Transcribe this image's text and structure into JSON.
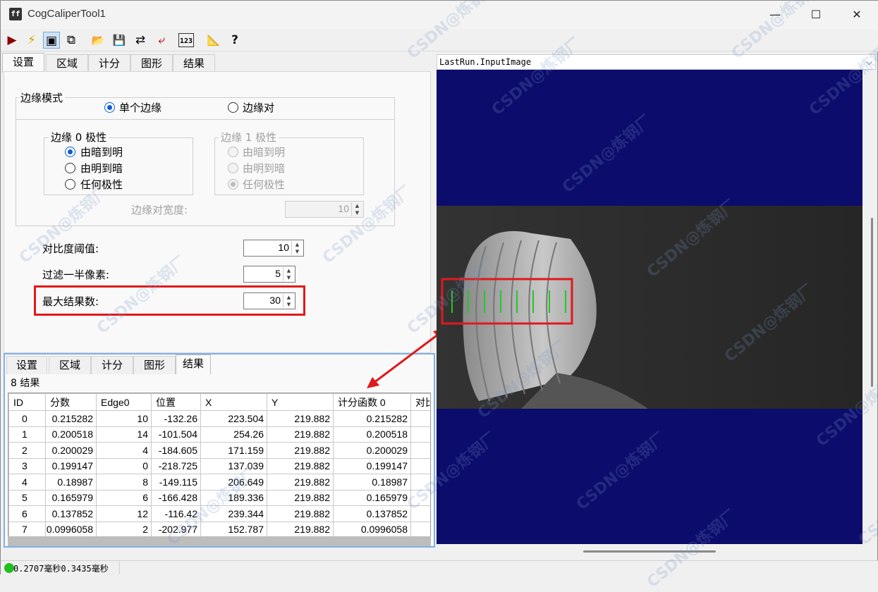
{
  "window": {
    "title": "CogCaliperTool1",
    "minimize": "—",
    "maximize": "☐",
    "close": "✕"
  },
  "toolbar": {
    "icons": [
      "run-icon",
      "electric-icon",
      "show-image-icon",
      "copy-image-icon",
      "open-icon",
      "save-icon",
      "reset-icon",
      "import-icon",
      "number-icon",
      "measure-icon",
      "help-icon"
    ],
    "glyphs": [
      "▶",
      "⚡",
      "▣",
      "⧉",
      "📂",
      "💾",
      "⇄",
      "⤶",
      "123",
      "📐",
      "?"
    ],
    "colors": {
      "run": "#8b0000",
      "lightning": "#f2c80f"
    }
  },
  "top_tabs": [
    "设置",
    "区域",
    "计分",
    "图形",
    "结果"
  ],
  "settings": {
    "edge_mode_title": "边缘模式",
    "edge_mode_single": "单个边缘",
    "edge_mode_pair": "边缘对",
    "edge0_title": "边缘 0 极性",
    "edge1_title": "边缘 1 极性",
    "polarity_options": [
      "由暗到明",
      "由明到暗",
      "任何极性"
    ],
    "pair_width_label": "边缘对宽度:",
    "pair_width_value": "10",
    "contrast_label": "对比度阈值:",
    "contrast_value": "10",
    "filter_label": "过滤一半像素:",
    "filter_value": "5",
    "max_results_label": "最大结果数:",
    "max_results_value": "30"
  },
  "results": {
    "tabs": [
      "设置",
      "区域",
      "计分",
      "图形",
      "结果"
    ],
    "count_label": "8 结果",
    "columns": [
      "ID",
      "分数",
      "Edge0",
      "位置",
      "X",
      "Y",
      "计分函数 0",
      "对比"
    ],
    "rows": [
      [
        "0",
        "0.215282",
        "10",
        "-132.26",
        "223.504",
        "219.882",
        "0.215282"
      ],
      [
        "1",
        "0.200518",
        "14",
        "-101.504",
        "254.26",
        "219.882",
        "0.200518"
      ],
      [
        "2",
        "0.200029",
        "4",
        "-184.605",
        "171.159",
        "219.882",
        "0.200029"
      ],
      [
        "3",
        "0.199147",
        "0",
        "-218.725",
        "137.039",
        "219.882",
        "0.199147"
      ],
      [
        "4",
        "0.18987",
        "8",
        "-149.115",
        "206.649",
        "219.882",
        "0.18987"
      ],
      [
        "5",
        "0.165979",
        "6",
        "-166.428",
        "189.336",
        "219.882",
        "0.165979"
      ],
      [
        "6",
        "0.137852",
        "12",
        "-116.42",
        "239.344",
        "219.882",
        "0.137852"
      ],
      [
        "7",
        "0.0996058",
        "2",
        "-202.977",
        "152.787",
        "219.882",
        "0.0996058"
      ]
    ]
  },
  "image_view": {
    "selected_image": "LastRun.InputImage",
    "background": "#0c0c6c",
    "edge_color": "#22c822"
  },
  "status": {
    "text": "0.2707毫秒0.3435毫秒",
    "indicator_color": "#22c01e"
  },
  "watermark": "CSDN@炼钢厂"
}
